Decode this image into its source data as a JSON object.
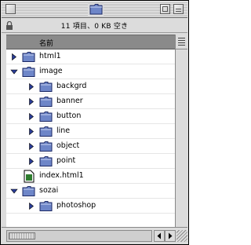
{
  "window": {
    "title_icon": "folder-icon",
    "info": "11 項目、0 KB 空き"
  },
  "columns": {
    "name_header": "名前"
  },
  "items": [
    {
      "label": "html1",
      "type": "folder",
      "expanded": false,
      "level": 0
    },
    {
      "label": "image",
      "type": "folder",
      "expanded": true,
      "level": 0
    },
    {
      "label": "backgrd",
      "type": "folder",
      "expanded": false,
      "level": 1
    },
    {
      "label": "banner",
      "type": "folder",
      "expanded": false,
      "level": 1
    },
    {
      "label": "button",
      "type": "folder",
      "expanded": false,
      "level": 1
    },
    {
      "label": "line",
      "type": "folder",
      "expanded": false,
      "level": 1
    },
    {
      "label": "object",
      "type": "folder",
      "expanded": false,
      "level": 1
    },
    {
      "label": "point",
      "type": "folder",
      "expanded": false,
      "level": 1
    },
    {
      "label": "index.html1",
      "type": "file",
      "expanded": false,
      "level": 0
    },
    {
      "label": "sozai",
      "type": "folder",
      "expanded": true,
      "level": 0
    },
    {
      "label": "photoshop",
      "type": "folder",
      "expanded": false,
      "level": 1
    }
  ],
  "colors": {
    "folder_blue": "#6e86c8",
    "triangle_blue": "#2a3d9a",
    "header_gray": "#8a8a8a"
  }
}
